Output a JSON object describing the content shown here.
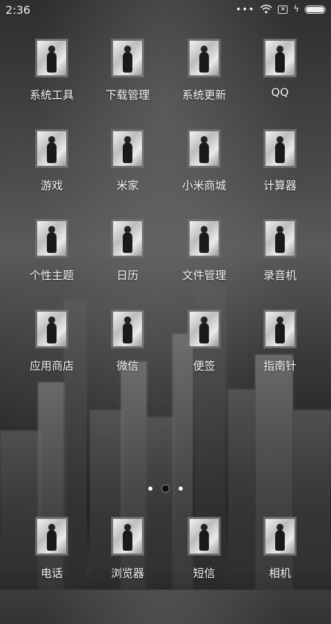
{
  "status_bar": {
    "time": "2:36",
    "icons": [
      "more-dots-icon",
      "wifi-icon",
      "no-sim-icon",
      "charging-bolt-icon",
      "battery-icon"
    ],
    "more_dots": "•••",
    "sim_glyph": "✕",
    "bolt_glyph": "ϟ",
    "battery_level": 1.0
  },
  "home_grid": {
    "rows": [
      [
        {
          "label": "系统工具"
        },
        {
          "label": "下载管理"
        },
        {
          "label": "系统更新"
        },
        {
          "label": "QQ"
        }
      ],
      [
        {
          "label": "游戏"
        },
        {
          "label": "米家"
        },
        {
          "label": "小米商城"
        },
        {
          "label": "计算器"
        }
      ],
      [
        {
          "label": "个性主题"
        },
        {
          "label": "日历"
        },
        {
          "label": "文件管理"
        },
        {
          "label": "录音机"
        }
      ],
      [
        {
          "label": "应用商店"
        },
        {
          "label": "微信"
        },
        {
          "label": "便签"
        },
        {
          "label": "指南针"
        }
      ]
    ]
  },
  "pager": {
    "count": 3,
    "active_index": 1
  },
  "dock": [
    {
      "label": "电话"
    },
    {
      "label": "浏览器"
    },
    {
      "label": "短信"
    },
    {
      "label": "相机"
    }
  ],
  "colors": {
    "icon_border": "#6e6e6e",
    "text": "#f5f5f5"
  }
}
